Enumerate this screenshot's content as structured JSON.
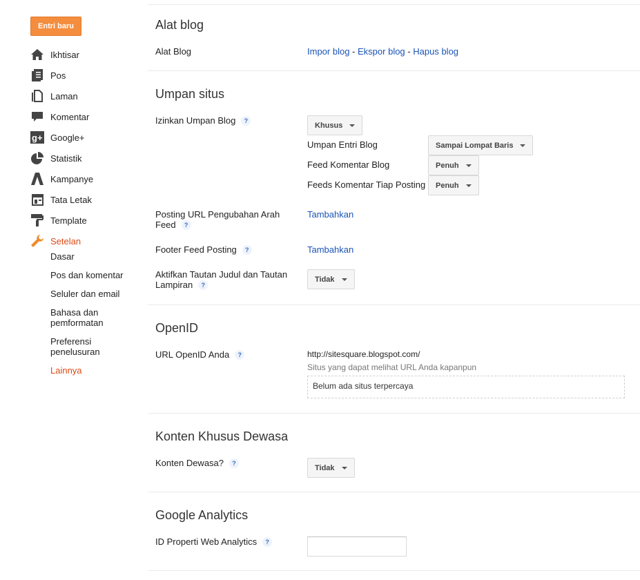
{
  "sidebar": {
    "new_post_label": "Entri baru",
    "items": [
      {
        "label": "Ikhtisar",
        "icon": "home-icon"
      },
      {
        "label": "Pos",
        "icon": "posts-icon"
      },
      {
        "label": "Laman",
        "icon": "pages-icon"
      },
      {
        "label": "Komentar",
        "icon": "comments-icon"
      },
      {
        "label": "Google+",
        "icon": "google-plus-icon"
      },
      {
        "label": "Statistik",
        "icon": "stats-icon"
      },
      {
        "label": "Kampanye",
        "icon": "campaign-icon"
      },
      {
        "label": "Tata Letak",
        "icon": "layout-icon"
      },
      {
        "label": "Template",
        "icon": "template-icon"
      },
      {
        "label": "Setelan",
        "icon": "wrench-icon"
      }
    ],
    "sub_items": [
      "Dasar",
      "Pos dan komentar",
      "Seluler dan email",
      "Bahasa dan pemformatan",
      "Preferensi penelusuran",
      "Lainnya"
    ]
  },
  "blog_tools": {
    "title": "Alat blog",
    "label": "Alat Blog",
    "import": "Impor blog",
    "export": "Ekspor blog",
    "delete": "Hapus blog",
    "sep": "-"
  },
  "feed": {
    "title": "Umpan situs",
    "allow_label": "Izinkan Umpan Blog",
    "allow_value": "Khusus",
    "post_feed_label": "Umpan Entri Blog",
    "post_feed_value": "Sampai Lompat Baris",
    "comment_feed_label": "Feed Komentar Blog",
    "comment_feed_value": "Penuh",
    "per_post_label": "Feeds Komentar Tiap Posting",
    "per_post_value": "Penuh",
    "redirect_label": "Posting URL Pengubahan Arah Feed",
    "redirect_action": "Tambahkan",
    "footer_label": "Footer Feed Posting",
    "footer_action": "Tambahkan",
    "enclosure_label": "Aktifkan Tautan Judul dan Tautan Lampiran",
    "enclosure_value": "Tidak"
  },
  "openid": {
    "title": "OpenID",
    "label": "URL OpenID Anda",
    "url": "http://sitesquare.blogspot.com/",
    "note": "Situs yang dapat melihat URL Anda kapanpun",
    "trusted": "Belum ada situs terpercaya"
  },
  "adult": {
    "title": "Konten Khusus Dewasa",
    "label": "Konten Dewasa?",
    "value": "Tidak"
  },
  "analytics": {
    "title": "Google Analytics",
    "label": "ID Properti Web Analytics",
    "value": ""
  },
  "help_glyph": "?"
}
